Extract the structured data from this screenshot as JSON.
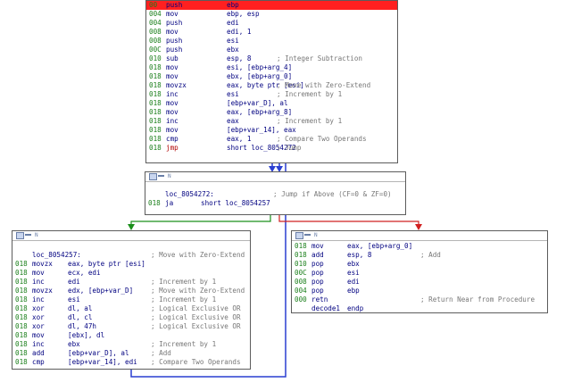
{
  "colors": {
    "highlight": "#ff2020",
    "address": "#1a7f1a",
    "mnemonic": "#000080",
    "comment": "#777777",
    "edge_blue": "#2a3fd1",
    "edge_green": "#1a8f1a",
    "edge_red": "#d12020"
  },
  "block_top": {
    "lines": [
      {
        "addr": "00",
        "mn": "push",
        "op": "ebp",
        "cm": ""
      },
      {
        "addr": "004",
        "mn": "mov",
        "op": "ebp, esp",
        "cm": ""
      },
      {
        "addr": "004",
        "mn": "push",
        "op": "edi",
        "cm": ""
      },
      {
        "addr": "008",
        "mn": "mov",
        "op": "edi, 1",
        "cm": ""
      },
      {
        "addr": "008",
        "mn": "push",
        "op": "esi",
        "cm": ""
      },
      {
        "addr": "00C",
        "mn": "push",
        "op": "ebx",
        "cm": ""
      },
      {
        "addr": "010",
        "mn": "sub",
        "op": "esp, 8",
        "cm": "; Integer Subtraction"
      },
      {
        "addr": "018",
        "mn": "mov",
        "op": "esi, [ebp+arg_4]",
        "cm": ""
      },
      {
        "addr": "018",
        "mn": "mov",
        "op": "ebx, [ebp+arg_0]",
        "cm": ""
      },
      {
        "addr": "018",
        "mn": "movzx",
        "op": "eax, byte ptr [esi]",
        "cm": "; Move with Zero-Extend"
      },
      {
        "addr": "018",
        "mn": "inc",
        "op": "esi",
        "cm": "; Increment by 1"
      },
      {
        "addr": "018",
        "mn": "mov",
        "op": "[ebp+var_D], al",
        "cm": ""
      },
      {
        "addr": "018",
        "mn": "mov",
        "op": "eax, [ebp+arg_8]",
        "cm": ""
      },
      {
        "addr": "018",
        "mn": "inc",
        "op": "eax",
        "cm": "; Increment by 1"
      },
      {
        "addr": "018",
        "mn": "mov",
        "op": "[ebp+var_14], eax",
        "cm": ""
      },
      {
        "addr": "018",
        "mn": "cmp",
        "op": "eax, 1",
        "cm": "; Compare Two Operands"
      },
      {
        "addr": "018",
        "mn": "jmp",
        "op": "short loc_8054272",
        "cm": "; Jump"
      }
    ]
  },
  "block_mid": {
    "title": "N",
    "lines": [
      {
        "addr": "",
        "mn": "",
        "op": "loc_8054272:",
        "cm": "; Jump if Above (CF=0 & ZF=0)"
      },
      {
        "addr": "018",
        "mn": "ja",
        "op": "short loc_8054257",
        "cm": ""
      }
    ]
  },
  "block_left": {
    "title": "N",
    "lines": [
      {
        "addr": "",
        "mn": "",
        "op": "loc_8054257:",
        "cm": "; Move with Zero-Extend"
      },
      {
        "addr": "018",
        "mn": "movzx",
        "op": "eax, byte ptr [esi]",
        "cm": ""
      },
      {
        "addr": "018",
        "mn": "mov",
        "op": "ecx, edi",
        "cm": ""
      },
      {
        "addr": "018",
        "mn": "inc",
        "op": "edi",
        "cm": "; Increment by 1"
      },
      {
        "addr": "018",
        "mn": "movzx",
        "op": "edx, [ebp+var_D]",
        "cm": "; Move with Zero-Extend"
      },
      {
        "addr": "018",
        "mn": "inc",
        "op": "esi",
        "cm": "; Increment by 1"
      },
      {
        "addr": "018",
        "mn": "xor",
        "op": "dl, al",
        "cm": "; Logical Exclusive OR"
      },
      {
        "addr": "018",
        "mn": "xor",
        "op": "dl, cl",
        "cm": "; Logical Exclusive OR"
      },
      {
        "addr": "018",
        "mn": "xor",
        "op": "dl, 47h",
        "cm": "; Logical Exclusive OR"
      },
      {
        "addr": "018",
        "mn": "mov",
        "op": "[ebx], dl",
        "cm": ""
      },
      {
        "addr": "018",
        "mn": "inc",
        "op": "ebx",
        "cm": "; Increment by 1"
      },
      {
        "addr": "018",
        "mn": "add",
        "op": "[ebp+var_D], al",
        "cm": "; Add"
      },
      {
        "addr": "018",
        "mn": "cmp",
        "op": "[ebp+var_14], edi",
        "cm": "; Compare Two Operands"
      }
    ]
  },
  "block_right": {
    "title": "N",
    "lines": [
      {
        "addr": "018",
        "mn": "mov",
        "op": "eax, [ebp+arg_0]",
        "cm": ""
      },
      {
        "addr": "018",
        "mn": "add",
        "op": "esp, 8",
        "cm": "; Add"
      },
      {
        "addr": "010",
        "mn": "pop",
        "op": "ebx",
        "cm": ""
      },
      {
        "addr": "00C",
        "mn": "pop",
        "op": "esi",
        "cm": ""
      },
      {
        "addr": "008",
        "mn": "pop",
        "op": "edi",
        "cm": ""
      },
      {
        "addr": "004",
        "mn": "pop",
        "op": "ebp",
        "cm": ""
      },
      {
        "addr": "000",
        "mn": "retn",
        "op": "",
        "cm": "; Return Near from Procedure"
      },
      {
        "addr": "",
        "mn": "decode1",
        "op": "endp",
        "cm": ""
      }
    ]
  }
}
